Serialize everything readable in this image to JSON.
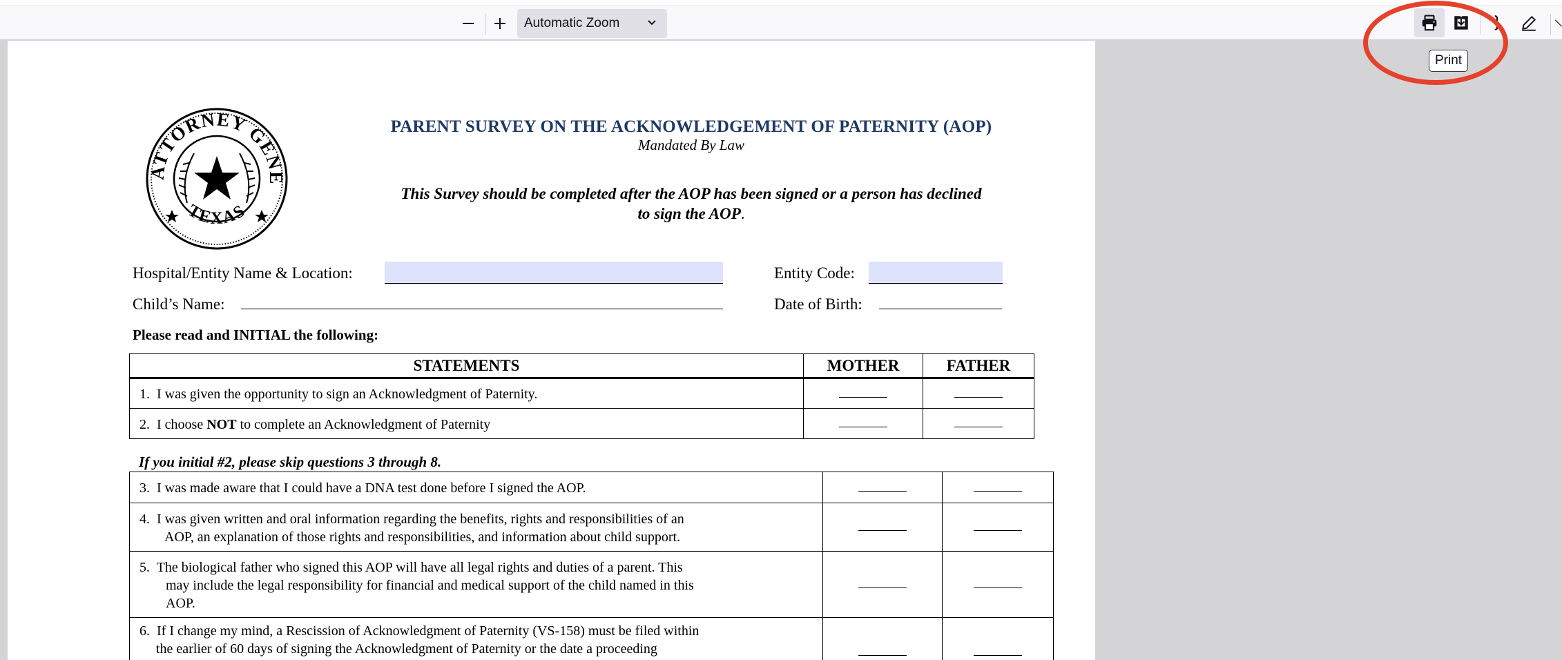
{
  "toolbar": {
    "zoom_out_glyph": "—",
    "zoom_in_glyph": "+",
    "zoom_level": "Automatic Zoom",
    "print_tooltip": "Print"
  },
  "colors": {
    "accent_ring": "#e5412b",
    "title_blue": "#1f3864",
    "field_fill": "#dde3fc"
  },
  "icons": [
    "zoom-out-icon",
    "zoom-in-icon",
    "chevron-down-icon",
    "print-icon",
    "save-icon",
    "text-icon",
    "draw-icon",
    "more-icon",
    "seal-icon"
  ],
  "seal": {
    "top_text": "THE ATTORNEY GENERAL",
    "bottom_text": "TEXAS"
  },
  "doc": {
    "title": "PARENT SURVEY ON THE ACKNOWLEDGEMENT OF PATERNITY (AOP)",
    "subtitle": "Mandated By Law",
    "instruction_line1": "This Survey should be completed after the AOP has been signed or a person has declined",
    "instruction_line2": "to sign the AOP",
    "instruction_period": ".",
    "fields": {
      "hospital_label": "Hospital/Entity Name & Location:",
      "entity_code_label": "Entity Code:",
      "child_name_label": "Child’s Name:",
      "dob_label": "Date of Birth:"
    },
    "read_heading": "Please read and INITIAL the following:",
    "table": {
      "headers": {
        "statements": "STATEMENTS",
        "mother": "MOTHER",
        "father": "FATHER"
      },
      "rows_a": [
        {
          "num": "1.",
          "text": "I was given the opportunity to sign an Acknowledgment of Paternity."
        },
        {
          "num": "2.",
          "pre": "I choose ",
          "bold": "NOT",
          "post": " to complete an Acknowledgment of Paternity"
        }
      ],
      "skip_note": "If you initial #2, please skip questions 3 through 8.",
      "rows_b": [
        {
          "num": "3.",
          "text": "I was made aware that I could have a DNA test done before I signed the AOP."
        },
        {
          "num": "4.",
          "text": "I was given written and oral information regarding the benefits, rights and responsibilities of an",
          "text2": "AOP, an explanation of those rights and responsibilities, and information about child support."
        },
        {
          "num": "5.",
          "text": "The biological father who signed this AOP will have all legal rights and duties of a parent.  This",
          "text2": "may include the legal responsibility for financial and medical support of the child named in this",
          "text3": "AOP."
        },
        {
          "num": "6.",
          "text": "If I change my mind, a Rescission of Acknowledgment of Paternity (VS-158) must be filed within",
          "text2": "the earlier of 60 days of signing the Acknowledgment of Paternity or the date a proceeding"
        }
      ]
    }
  }
}
